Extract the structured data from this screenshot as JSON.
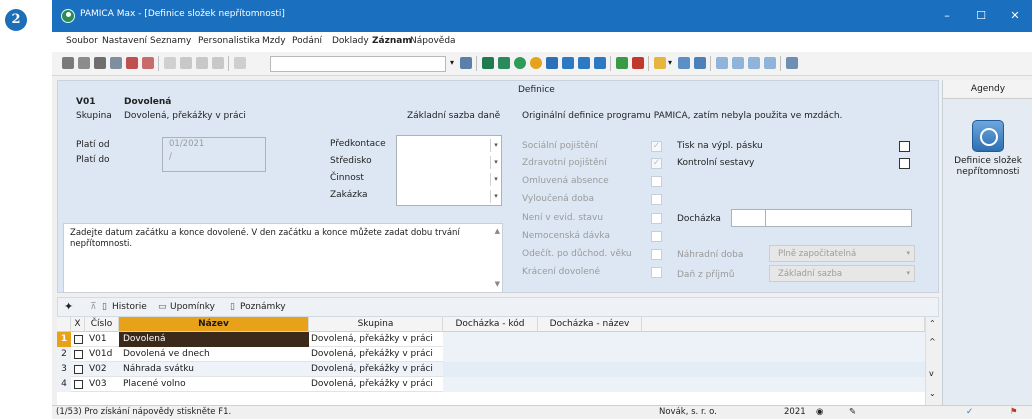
{
  "badge": "2",
  "window": {
    "title": "PAMICA Max - [Definice složek nepřítomnosti]",
    "controls": {
      "minimize": "–",
      "maximize": "☐",
      "close": "✕"
    }
  },
  "menu": [
    {
      "label": "Soubor"
    },
    {
      "label": "Nastavení"
    },
    {
      "label": "Seznamy"
    },
    {
      "label": "Personalistika"
    },
    {
      "label": "Mzdy"
    },
    {
      "label": "Podání"
    },
    {
      "label": "Doklady"
    },
    {
      "label": "Záznam"
    },
    {
      "label": "Nápověda"
    }
  ],
  "detail": {
    "code": "V01",
    "name": "Dovolená",
    "skupina_label": "Skupina",
    "skupina_value": "Dovolená, překážky v práci",
    "zakladni_sazba_dane": "Základní sazba daně",
    "plati_od_label": "Platí od",
    "plati_od_value": "01/2021",
    "plati_do_label": "Platí do",
    "plati_do_value": "/",
    "predkontace": "Předkontace",
    "stredisko": "Středisko",
    "cinnost": "Činnost",
    "zakazka": "Zakázka",
    "note": "Zadejte datum začátku a konce dovolené. V den začátku a konce můžete zadat dobu trvání nepřítomnosti.",
    "definice_title": "Definice",
    "definice_text": "Originální definice programu PAMICA, zatím nebyla použita ve mzdách.",
    "checks_left": [
      {
        "label": "Sociální pojištění",
        "checked": true
      },
      {
        "label": "Zdravotní pojištění",
        "checked": true
      },
      {
        "label": "Omluvená absence",
        "checked": false
      },
      {
        "label": "Vyloučená doba",
        "checked": false
      },
      {
        "label": "Není v evid. stavu",
        "checked": false
      },
      {
        "label": "Nemocenská dávka",
        "checked": false
      },
      {
        "label": "Odečít. po důchod. věku",
        "checked": false
      },
      {
        "label": "Krácení dovolené",
        "checked": false
      }
    ],
    "tisk_na_vypl_pasku": "Tisk na výpl. pásku",
    "kontrolni_sestavy": "Kontrolní sestavy",
    "dochazka_label": "Docházka",
    "nahradni_doba_label": "Náhradní doba",
    "nahradni_doba_value": "Plně započitatelná",
    "dan_z_prijmu_label": "Daň z příjmů",
    "dan_z_prijmu_value": "Základní sazba"
  },
  "tabs": [
    {
      "label": "Historie"
    },
    {
      "label": "Upomínky"
    },
    {
      "label": "Poznámky"
    }
  ],
  "grid": {
    "headers": {
      "x": "X",
      "cislo": "Číslo",
      "nazev": "Název",
      "skupina": "Skupina",
      "dochazka_kod": "Docházka - kód",
      "dochazka_nazev": "Docházka - název"
    },
    "rows": [
      {
        "n": "1",
        "cislo": "V01",
        "nazev": "Dovolená",
        "skupina": "Dovolená, překážky v práci"
      },
      {
        "n": "2",
        "cislo": "V01d",
        "nazev": "Dovolená ve dnech",
        "skupina": "Dovolená, překážky v práci"
      },
      {
        "n": "3",
        "cislo": "V02",
        "nazev": "Náhrada svátku",
        "skupina": "Dovolená, překážky v práci"
      },
      {
        "n": "4",
        "cislo": "V03",
        "nazev": "Placené volno",
        "skupina": "Dovolená, překážky v práci"
      }
    ]
  },
  "status": {
    "help": "(1/53) Pro získání nápovědy stiskněte F1.",
    "company": "Novák, s. r. o.",
    "year": "2021"
  },
  "agendy": {
    "title": "Agendy",
    "item": "Definice složek nepřítomnosti"
  },
  "colors": {
    "titlebar": "#1b6fbf",
    "selected_row": "#3b2a1a",
    "header_selected": "#e8a21a"
  }
}
